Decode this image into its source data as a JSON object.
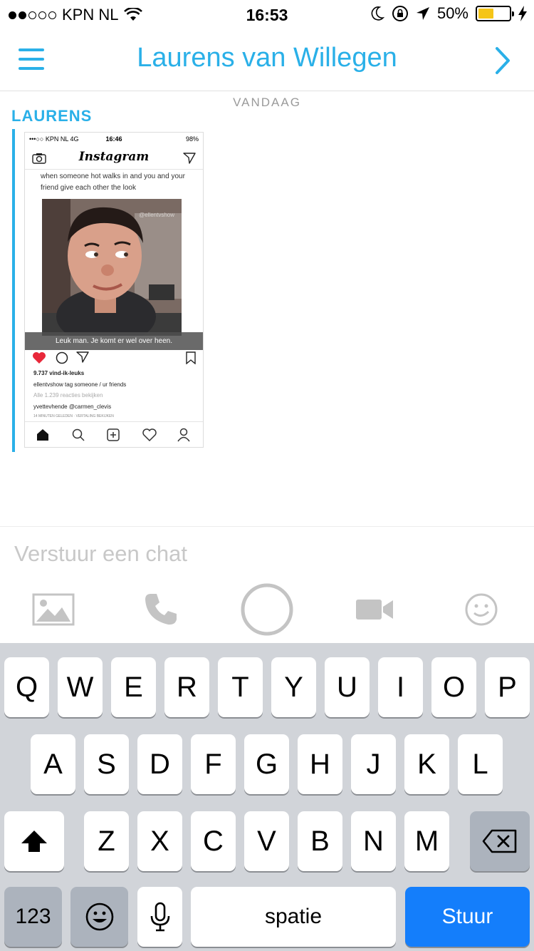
{
  "status_bar": {
    "carrier": "KPN NL",
    "time": "16:53",
    "battery": "50%",
    "battery_level": 0.5
  },
  "header": {
    "title": "Laurens van Willegen"
  },
  "chat": {
    "day_label": "VANDAAG",
    "sender": "LAURENS",
    "shared_screenshot": {
      "status_left": "•••○○ KPN NL  4G",
      "status_time": "16:46",
      "status_right": "98%",
      "app_name": "Instagram",
      "caption": "when someone hot walks in and you and your friend give each other the look",
      "watermark": "@ellentvshow",
      "overlay_text": "Leuk man. Je komt er wel over heen.",
      "likes": "9.737 vind-ik-leuks",
      "post_caption": "ellentvshow tag someone / ur friends",
      "view_comments": "Alle 1.239 reacties bekijken",
      "comment": "yvettevhende @carmen_clevis",
      "timestamp": "14 MINUTEN GELEDEN · VERTALING BEKIJKEN"
    }
  },
  "composer": {
    "placeholder": "Verstuur een chat"
  },
  "keyboard": {
    "row1": [
      "Q",
      "W",
      "E",
      "R",
      "T",
      "Y",
      "U",
      "I",
      "O",
      "P"
    ],
    "row2": [
      "A",
      "S",
      "D",
      "F",
      "G",
      "H",
      "J",
      "K",
      "L"
    ],
    "row3": [
      "Z",
      "X",
      "C",
      "V",
      "B",
      "N",
      "M"
    ],
    "numbers_key": "123",
    "space_key": "spatie",
    "send_key": "Stuur"
  },
  "colors": {
    "accent": "#2ab0e8",
    "send": "#147efb",
    "keyboard_bg": "#d1d4d9"
  }
}
